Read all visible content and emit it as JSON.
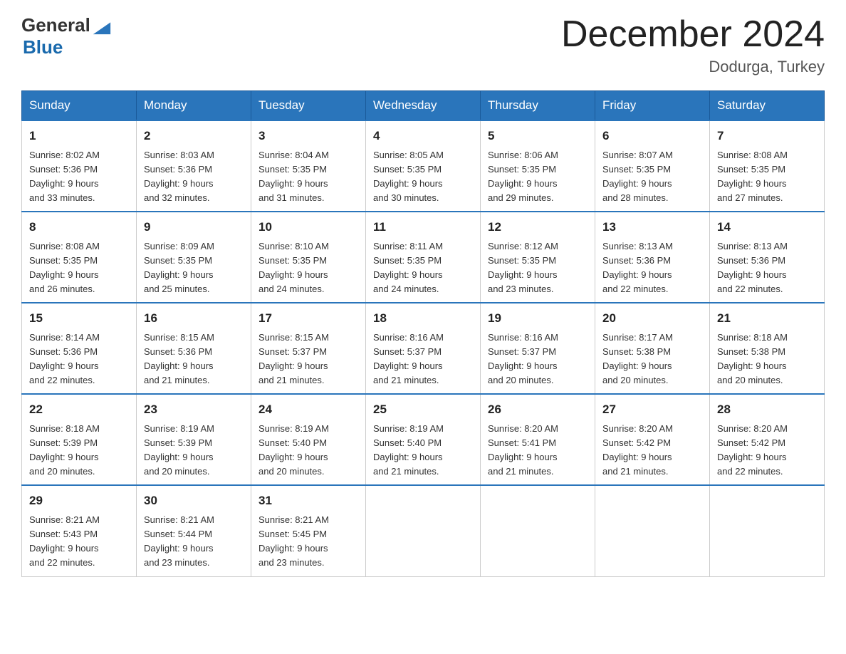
{
  "header": {
    "logo": {
      "general": "General",
      "blue": "Blue"
    },
    "title": "December 2024",
    "location": "Dodurga, Turkey"
  },
  "calendar": {
    "days_of_week": [
      "Sunday",
      "Monday",
      "Tuesday",
      "Wednesday",
      "Thursday",
      "Friday",
      "Saturday"
    ],
    "weeks": [
      [
        {
          "day": "1",
          "sunrise": "8:02 AM",
          "sunset": "5:36 PM",
          "daylight": "9 hours and 33 minutes."
        },
        {
          "day": "2",
          "sunrise": "8:03 AM",
          "sunset": "5:36 PM",
          "daylight": "9 hours and 32 minutes."
        },
        {
          "day": "3",
          "sunrise": "8:04 AM",
          "sunset": "5:35 PM",
          "daylight": "9 hours and 31 minutes."
        },
        {
          "day": "4",
          "sunrise": "8:05 AM",
          "sunset": "5:35 PM",
          "daylight": "9 hours and 30 minutes."
        },
        {
          "day": "5",
          "sunrise": "8:06 AM",
          "sunset": "5:35 PM",
          "daylight": "9 hours and 29 minutes."
        },
        {
          "day": "6",
          "sunrise": "8:07 AM",
          "sunset": "5:35 PM",
          "daylight": "9 hours and 28 minutes."
        },
        {
          "day": "7",
          "sunrise": "8:08 AM",
          "sunset": "5:35 PM",
          "daylight": "9 hours and 27 minutes."
        }
      ],
      [
        {
          "day": "8",
          "sunrise": "8:08 AM",
          "sunset": "5:35 PM",
          "daylight": "9 hours and 26 minutes."
        },
        {
          "day": "9",
          "sunrise": "8:09 AM",
          "sunset": "5:35 PM",
          "daylight": "9 hours and 25 minutes."
        },
        {
          "day": "10",
          "sunrise": "8:10 AM",
          "sunset": "5:35 PM",
          "daylight": "9 hours and 24 minutes."
        },
        {
          "day": "11",
          "sunrise": "8:11 AM",
          "sunset": "5:35 PM",
          "daylight": "9 hours and 24 minutes."
        },
        {
          "day": "12",
          "sunrise": "8:12 AM",
          "sunset": "5:35 PM",
          "daylight": "9 hours and 23 minutes."
        },
        {
          "day": "13",
          "sunrise": "8:13 AM",
          "sunset": "5:36 PM",
          "daylight": "9 hours and 22 minutes."
        },
        {
          "day": "14",
          "sunrise": "8:13 AM",
          "sunset": "5:36 PM",
          "daylight": "9 hours and 22 minutes."
        }
      ],
      [
        {
          "day": "15",
          "sunrise": "8:14 AM",
          "sunset": "5:36 PM",
          "daylight": "9 hours and 22 minutes."
        },
        {
          "day": "16",
          "sunrise": "8:15 AM",
          "sunset": "5:36 PM",
          "daylight": "9 hours and 21 minutes."
        },
        {
          "day": "17",
          "sunrise": "8:15 AM",
          "sunset": "5:37 PM",
          "daylight": "9 hours and 21 minutes."
        },
        {
          "day": "18",
          "sunrise": "8:16 AM",
          "sunset": "5:37 PM",
          "daylight": "9 hours and 21 minutes."
        },
        {
          "day": "19",
          "sunrise": "8:16 AM",
          "sunset": "5:37 PM",
          "daylight": "9 hours and 20 minutes."
        },
        {
          "day": "20",
          "sunrise": "8:17 AM",
          "sunset": "5:38 PM",
          "daylight": "9 hours and 20 minutes."
        },
        {
          "day": "21",
          "sunrise": "8:18 AM",
          "sunset": "5:38 PM",
          "daylight": "9 hours and 20 minutes."
        }
      ],
      [
        {
          "day": "22",
          "sunrise": "8:18 AM",
          "sunset": "5:39 PM",
          "daylight": "9 hours and 20 minutes."
        },
        {
          "day": "23",
          "sunrise": "8:19 AM",
          "sunset": "5:39 PM",
          "daylight": "9 hours and 20 minutes."
        },
        {
          "day": "24",
          "sunrise": "8:19 AM",
          "sunset": "5:40 PM",
          "daylight": "9 hours and 20 minutes."
        },
        {
          "day": "25",
          "sunrise": "8:19 AM",
          "sunset": "5:40 PM",
          "daylight": "9 hours and 21 minutes."
        },
        {
          "day": "26",
          "sunrise": "8:20 AM",
          "sunset": "5:41 PM",
          "daylight": "9 hours and 21 minutes."
        },
        {
          "day": "27",
          "sunrise": "8:20 AM",
          "sunset": "5:42 PM",
          "daylight": "9 hours and 21 minutes."
        },
        {
          "day": "28",
          "sunrise": "8:20 AM",
          "sunset": "5:42 PM",
          "daylight": "9 hours and 22 minutes."
        }
      ],
      [
        {
          "day": "29",
          "sunrise": "8:21 AM",
          "sunset": "5:43 PM",
          "daylight": "9 hours and 22 minutes."
        },
        {
          "day": "30",
          "sunrise": "8:21 AM",
          "sunset": "5:44 PM",
          "daylight": "9 hours and 23 minutes."
        },
        {
          "day": "31",
          "sunrise": "8:21 AM",
          "sunset": "5:45 PM",
          "daylight": "9 hours and 23 minutes."
        },
        null,
        null,
        null,
        null
      ]
    ]
  },
  "labels": {
    "sunrise_prefix": "Sunrise: ",
    "sunset_prefix": "Sunset: ",
    "daylight_prefix": "Daylight: "
  }
}
